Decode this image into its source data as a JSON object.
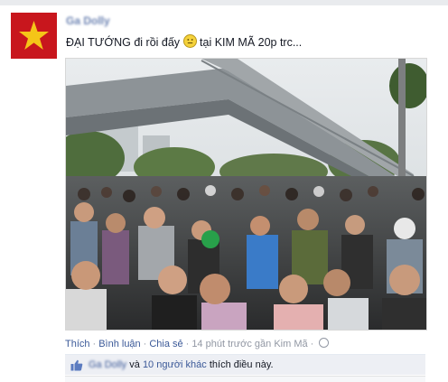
{
  "post": {
    "author": "Ga Dolly",
    "status_prefix": "ĐẠI TƯỚNG đi rồi đấy",
    "status_suffix": "tại KIM MÃ 20p trc...",
    "emoji_icon": "smiley-face-icon"
  },
  "actions": {
    "like": "Thích",
    "comment": "Bình luận",
    "share": "Chia sẻ",
    "timestamp": "14 phút trước gần Kim Mã",
    "privacy_icon": "globe-icon"
  },
  "likes": {
    "icon": "thumbs-up-icon",
    "name": "Ga Dolly",
    "conjunction": "và",
    "others": "10 người khác",
    "suffix": "thích điều này."
  },
  "colors": {
    "link": "#3b5998",
    "avatar_bg": "#c8161d",
    "star": "#f5c518",
    "likes_bg": "#edeff4"
  }
}
